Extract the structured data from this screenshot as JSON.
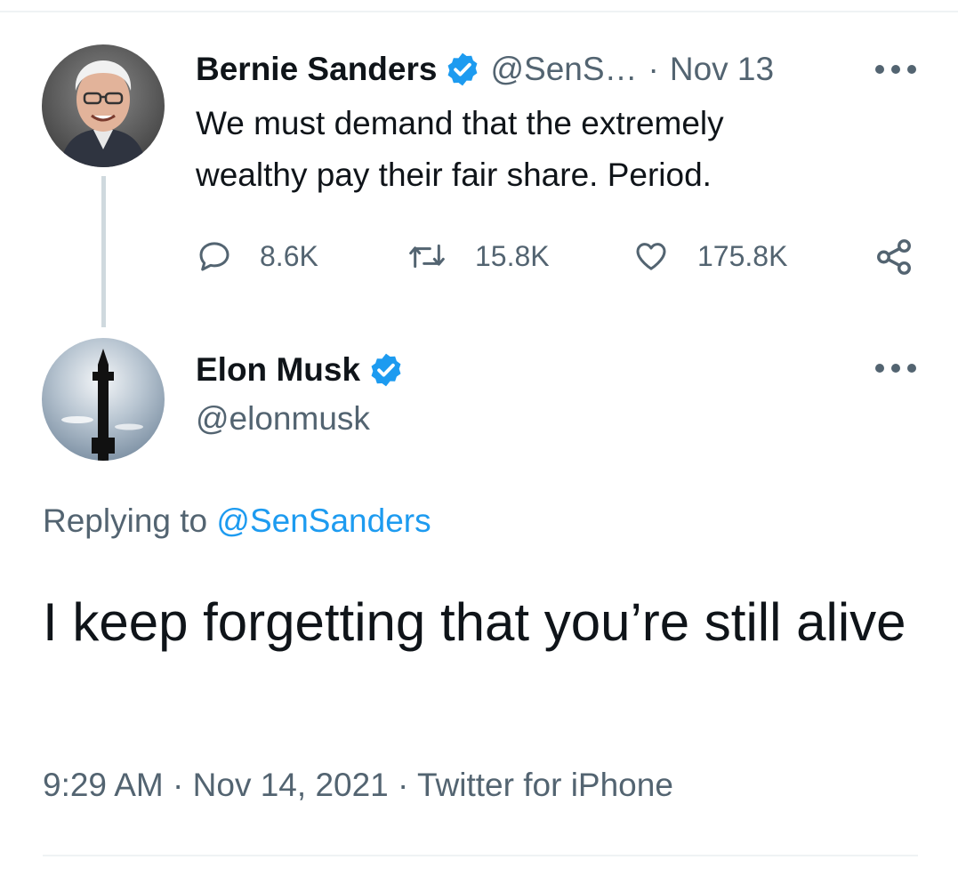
{
  "original_tweet": {
    "author_name": "Bernie Sanders",
    "handle": "@SenS…",
    "separator": "·",
    "date": "Nov 13",
    "text": "We must demand that the extremely wealthy pay their fair share. Period.",
    "stats": {
      "replies": "8.6K",
      "retweets": "15.8K",
      "likes": "175.8K"
    }
  },
  "reply_tweet": {
    "author_name": "Elon Musk",
    "handle": "@elonmusk",
    "replying_prefix": "Replying to",
    "replying_to": "@SenSanders",
    "text": "I keep forgetting that you’re still alive",
    "time": "9:29 AM",
    "separator": "·",
    "date": "Nov 14, 2021",
    "source": "Twitter for iPhone"
  },
  "icons": {
    "verified": "verified-badge-icon",
    "reply": "reply-icon",
    "retweet": "retweet-icon",
    "like": "like-icon",
    "share": "share-icon",
    "more": "more-options-icon"
  },
  "colors": {
    "accent": "#1d9bf0",
    "muted_text": "#536471",
    "primary_text": "#0f1419",
    "divider": "#eff3f4"
  }
}
